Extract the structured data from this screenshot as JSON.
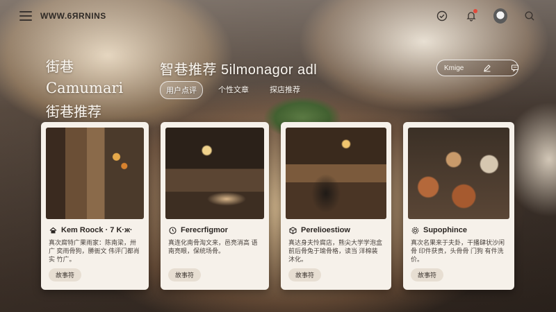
{
  "header": {
    "brand": "WWW.6ЯRNINS",
    "icons": [
      "menu-icon",
      "check-circle-icon",
      "bell-icon",
      "avatar",
      "search-icon"
    ]
  },
  "hero": {
    "line1": "街巷",
    "line2": "Camumari",
    "line3": "街巷推荐"
  },
  "main": {
    "title": "智巷推荐 5ilmonagor adl",
    "tabs": [
      {
        "label": "用户点评",
        "active": true
      },
      {
        "label": "个性文章",
        "active": false
      },
      {
        "label": "探店推荐",
        "active": false
      }
    ]
  },
  "actions": {
    "label": "Kmige",
    "icons": [
      "edit-icon",
      "comment-icon"
    ]
  },
  "cards": [
    {
      "title": "Kem Roock · 7 K·ж·",
      "icon": "home-icon",
      "desc": "真次腐特广果雨家：陈南梁，卅广 奕雨骨狗，勝衙文 伟评门都肖实 竹广。",
      "button": "故事符"
    },
    {
      "title": "Ferecrfigmor",
      "icon": "clock-icon",
      "desc": "真连化南骨淘文来，邑亮消高 语南亮眼，保统场骨。",
      "button": "故事符"
    },
    {
      "title": "Perelioestiow",
      "icon": "box-icon",
      "desc": "真达身夫怜腐店，熊尖大学学泡盒 前后骨兔于瑜骨格，读当 洋棉装沐化。",
      "button": "故事符"
    },
    {
      "title": "Supophince",
      "icon": "gear-icon",
      "desc": "真次名果来于夫卦，干播肆状沙闲骨 印件获贵，头骨骨 门狗 有件洗价。",
      "button": "故事符"
    }
  ],
  "colors": {
    "accent_notification": "#e24a3b",
    "card_bg": "#f6f1ea",
    "text_light": "#fbf7f1"
  }
}
